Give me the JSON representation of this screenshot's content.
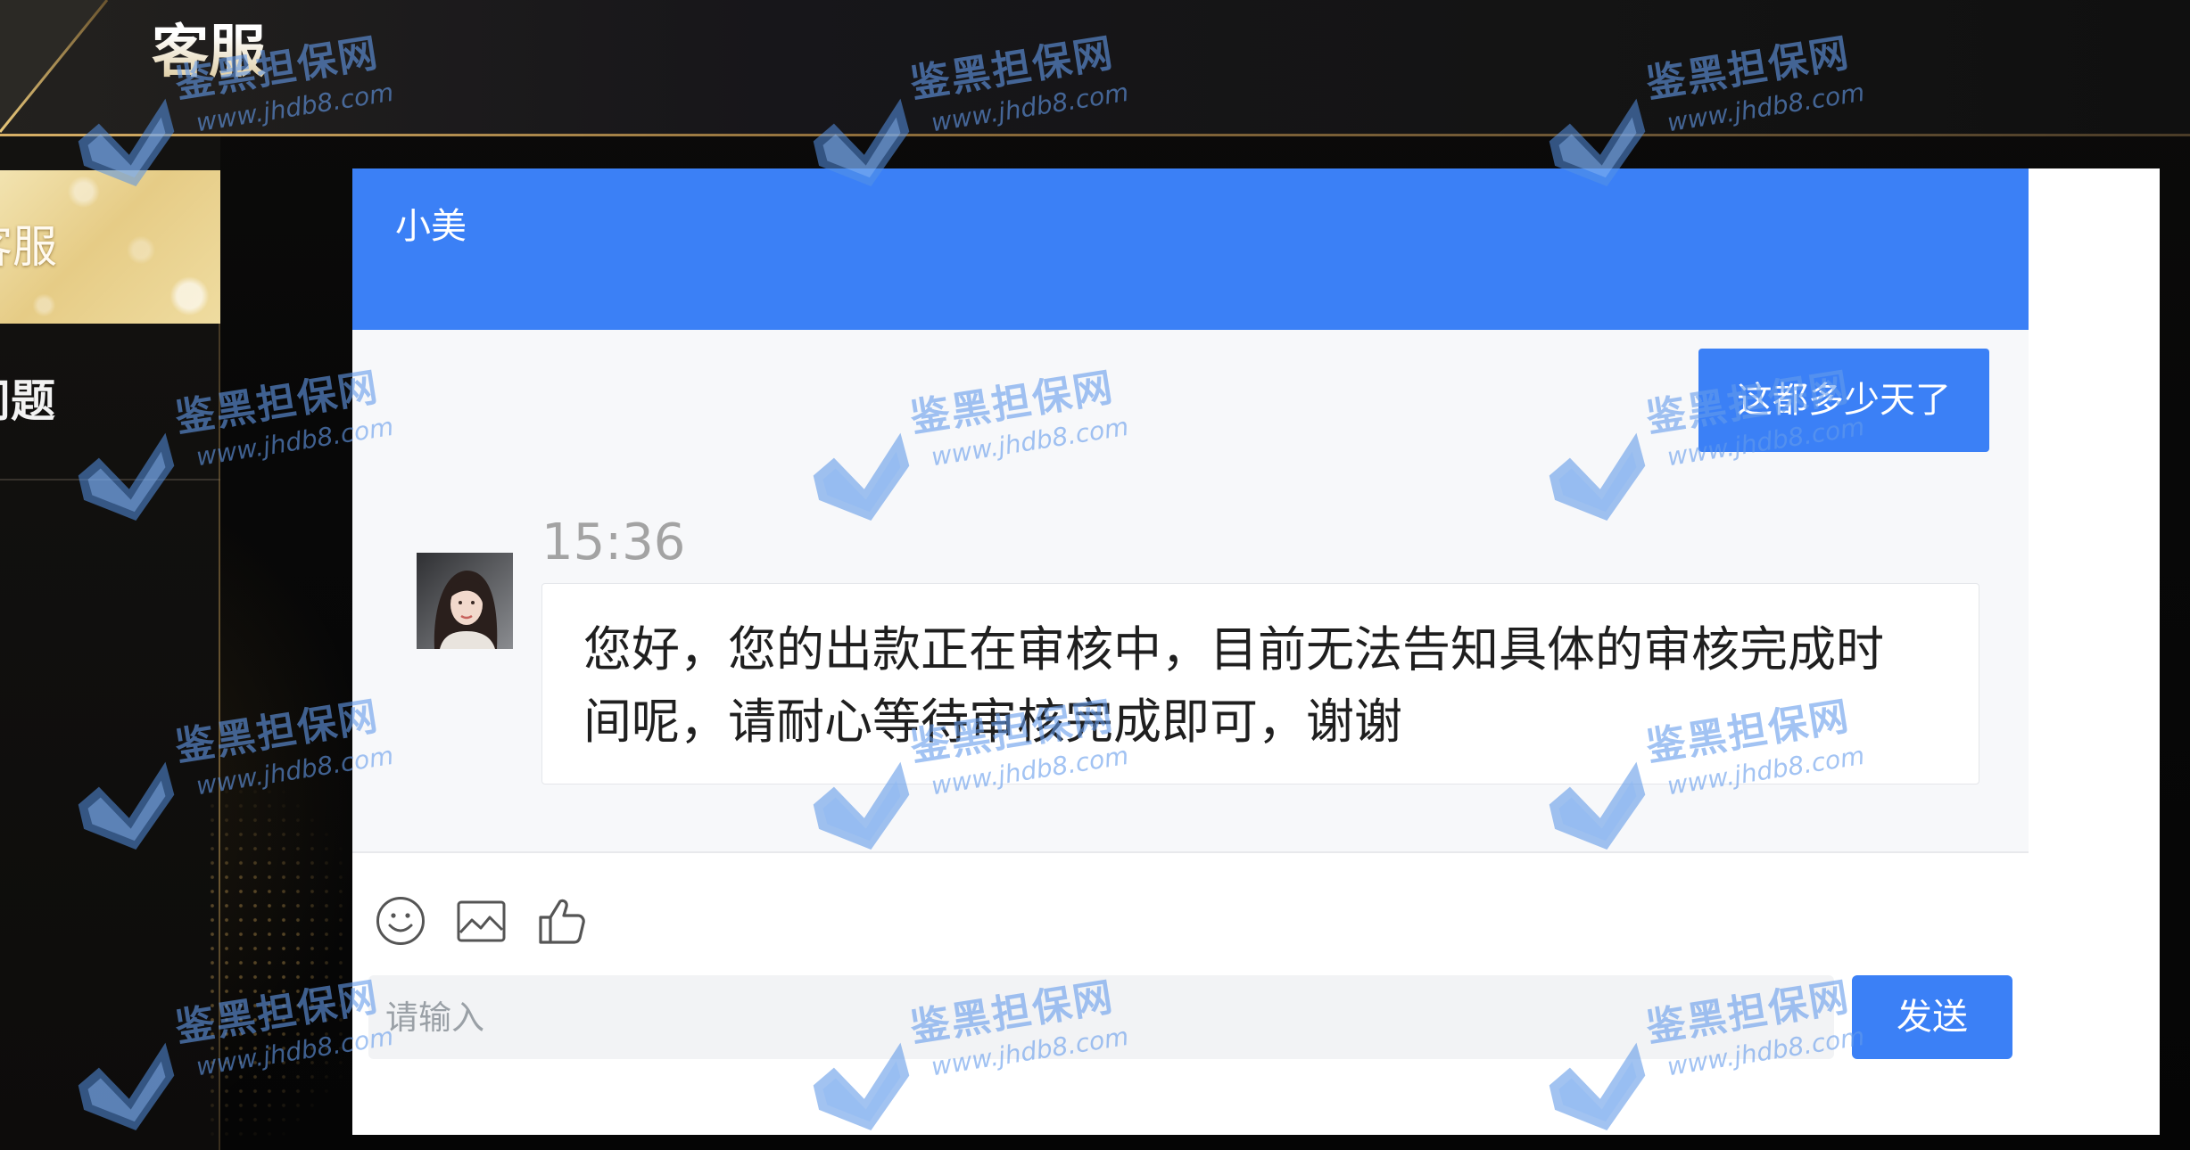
{
  "header": {
    "title": "客服"
  },
  "sidebar": {
    "items": [
      {
        "label": "客服",
        "active": true
      },
      {
        "label": "问题",
        "active": false
      }
    ]
  },
  "chat": {
    "agent_name": "小美",
    "messages": [
      {
        "direction": "outgoing",
        "text": "这都多少天了"
      },
      {
        "direction": "incoming",
        "time": "15:36",
        "text": "您好，您的出款正在审核中，目前无法告知具体的审核完成时间呢，请耐心等待审核完成即可，谢谢"
      }
    ],
    "toolbar": {
      "icons": [
        "emoji-icon",
        "image-icon",
        "thumbs-up-icon"
      ]
    },
    "input": {
      "placeholder": "请输入",
      "value": ""
    },
    "send_label": "发送"
  },
  "watermark": {
    "name": "鉴黑担保网",
    "url": "www.jhdb8.com"
  },
  "colors": {
    "accent": "#3b80f6",
    "gold": "#e6cc86",
    "message_area": "#f7f8fa",
    "timestamp": "#a3a3a3"
  }
}
